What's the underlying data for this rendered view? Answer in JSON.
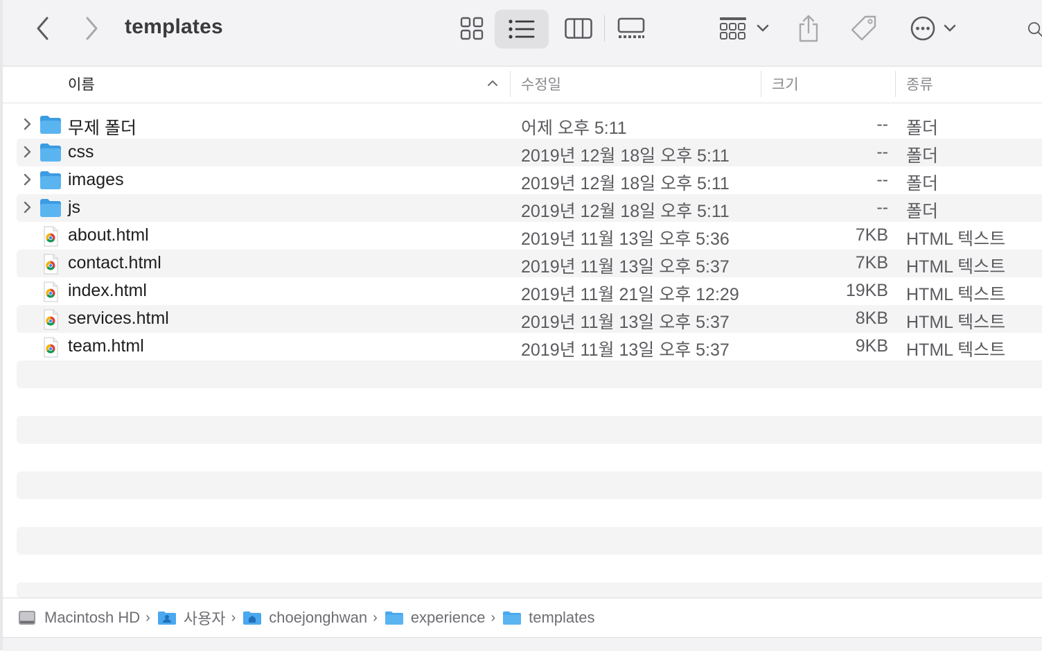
{
  "window": {
    "title": "templates"
  },
  "toolbar": {
    "icons": [
      "chevron-left",
      "chevron-right",
      "icon-view",
      "list-view",
      "column-view",
      "gallery-view",
      "group-by",
      "share",
      "tag",
      "more-actions",
      "search"
    ]
  },
  "columns": {
    "name": "이름",
    "date": "수정일",
    "size": "크기",
    "kind": "종류"
  },
  "files": [
    {
      "name": "무제 폴더",
      "date": "어제 오후 5:11",
      "size": "--",
      "kind": "폴더",
      "type": "folder"
    },
    {
      "name": "css",
      "date": "2019년 12월 18일 오후 5:11",
      "size": "--",
      "kind": "폴더",
      "type": "folder"
    },
    {
      "name": "images",
      "date": "2019년 12월 18일 오후 5:11",
      "size": "--",
      "kind": "폴더",
      "type": "folder"
    },
    {
      "name": "js",
      "date": "2019년 12월 18일 오후 5:11",
      "size": "--",
      "kind": "폴더",
      "type": "folder"
    },
    {
      "name": "about.html",
      "date": "2019년 11월 13일 오후 5:36",
      "size": "7KB",
      "kind": "HTML 텍스트",
      "type": "html"
    },
    {
      "name": "contact.html",
      "date": "2019년 11월 13일 오후 5:37",
      "size": "7KB",
      "kind": "HTML 텍스트",
      "type": "html"
    },
    {
      "name": "index.html",
      "date": "2019년 11월 21일 오후 12:29",
      "size": "19KB",
      "kind": "HTML 텍스트",
      "type": "html"
    },
    {
      "name": "services.html",
      "date": "2019년 11월 13일 오후 5:37",
      "size": "8KB",
      "kind": "HTML 텍스트",
      "type": "html"
    },
    {
      "name": "team.html",
      "date": "2019년 11월 13일 오후 5:37",
      "size": "9KB",
      "kind": "HTML 텍스트",
      "type": "html"
    }
  ],
  "path_bar": {
    "crumbs": [
      {
        "label": "Macintosh HD",
        "icon": "hard-drive-icon"
      },
      {
        "label": "사용자",
        "icon": "users-folder-icon"
      },
      {
        "label": "choejonghwan",
        "icon": "home-folder-icon"
      },
      {
        "label": "experience",
        "icon": "folder-icon"
      },
      {
        "label": "templates",
        "icon": "folder-icon"
      }
    ]
  },
  "colors": {
    "folder": "#5ab4f0",
    "folder_dark": "#3b9be3",
    "stripe": "#f4f4f5",
    "toolbar_bg": "#f3f3f5"
  }
}
